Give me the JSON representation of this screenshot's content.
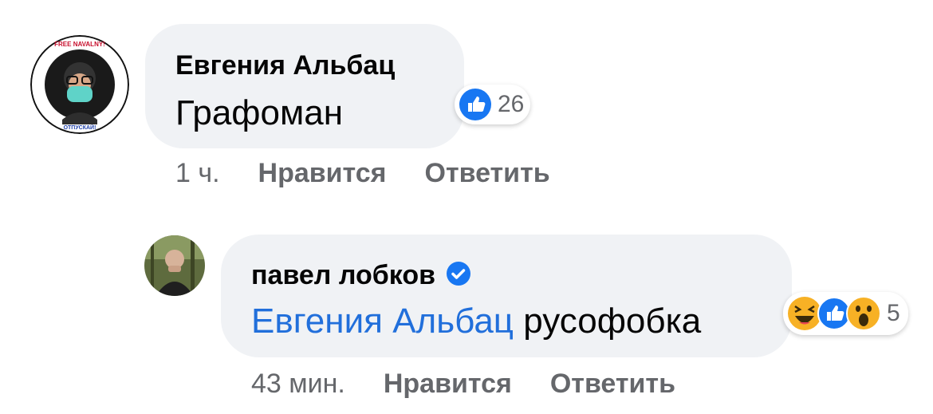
{
  "comments": [
    {
      "author": "Евгения Альбац",
      "text": "Графоман",
      "reaction_count": "26",
      "time": "1 ч.",
      "like_label": "Нравится",
      "reply_label": "Ответить",
      "avatar_ring_text": "FREE NAVALNY! СВОБОДУ НАВАЛЬНОМУ! ОТПУСКАЙ!"
    },
    {
      "author": "павел лобков",
      "verified": true,
      "mention": "Евгения Альбац",
      "text": "русофобка",
      "reaction_count": "5",
      "time": "43 мин.",
      "like_label": "Нравится",
      "reply_label": "Ответить"
    }
  ],
  "colors": {
    "bubble": "#f0f2f5",
    "mention": "#216fdb",
    "like_blue": "#1877f2",
    "meta_gray": "#65676b"
  }
}
